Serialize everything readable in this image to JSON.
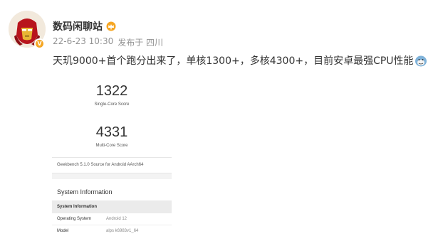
{
  "post": {
    "author": "数码闲聊站",
    "verified_badge": "V",
    "date": "22-6-23 10:30",
    "source": "发布于 四川",
    "text": "天玑9000+首个跑分出来了，单核1300+，多核4300+，目前安卓最强CPU性能"
  },
  "screenshot": {
    "single_core_score": "1322",
    "single_core_label": "Single-Core Score",
    "multi_core_score": "4331",
    "multi_core_label": "Multi-Core Score",
    "source_line": "Geekbench 5.1.0 Source for Android AArch64",
    "section_title": "System Information",
    "table_header": "System Information",
    "rows": [
      {
        "key": "Operating System",
        "value": "Android 12"
      },
      {
        "key": "Model",
        "value": "alps k6983v1_64"
      }
    ]
  },
  "icons": {
    "avatar": "iron-man-avatar",
    "verified": "verified-badge-icon",
    "vip": "vip-crown-icon",
    "emoji": "doge-emoji-icon"
  },
  "colors": {
    "meta_gray": "#939393",
    "badge_orange": "#f5a623",
    "table_header_bg": "#ebebeb"
  }
}
